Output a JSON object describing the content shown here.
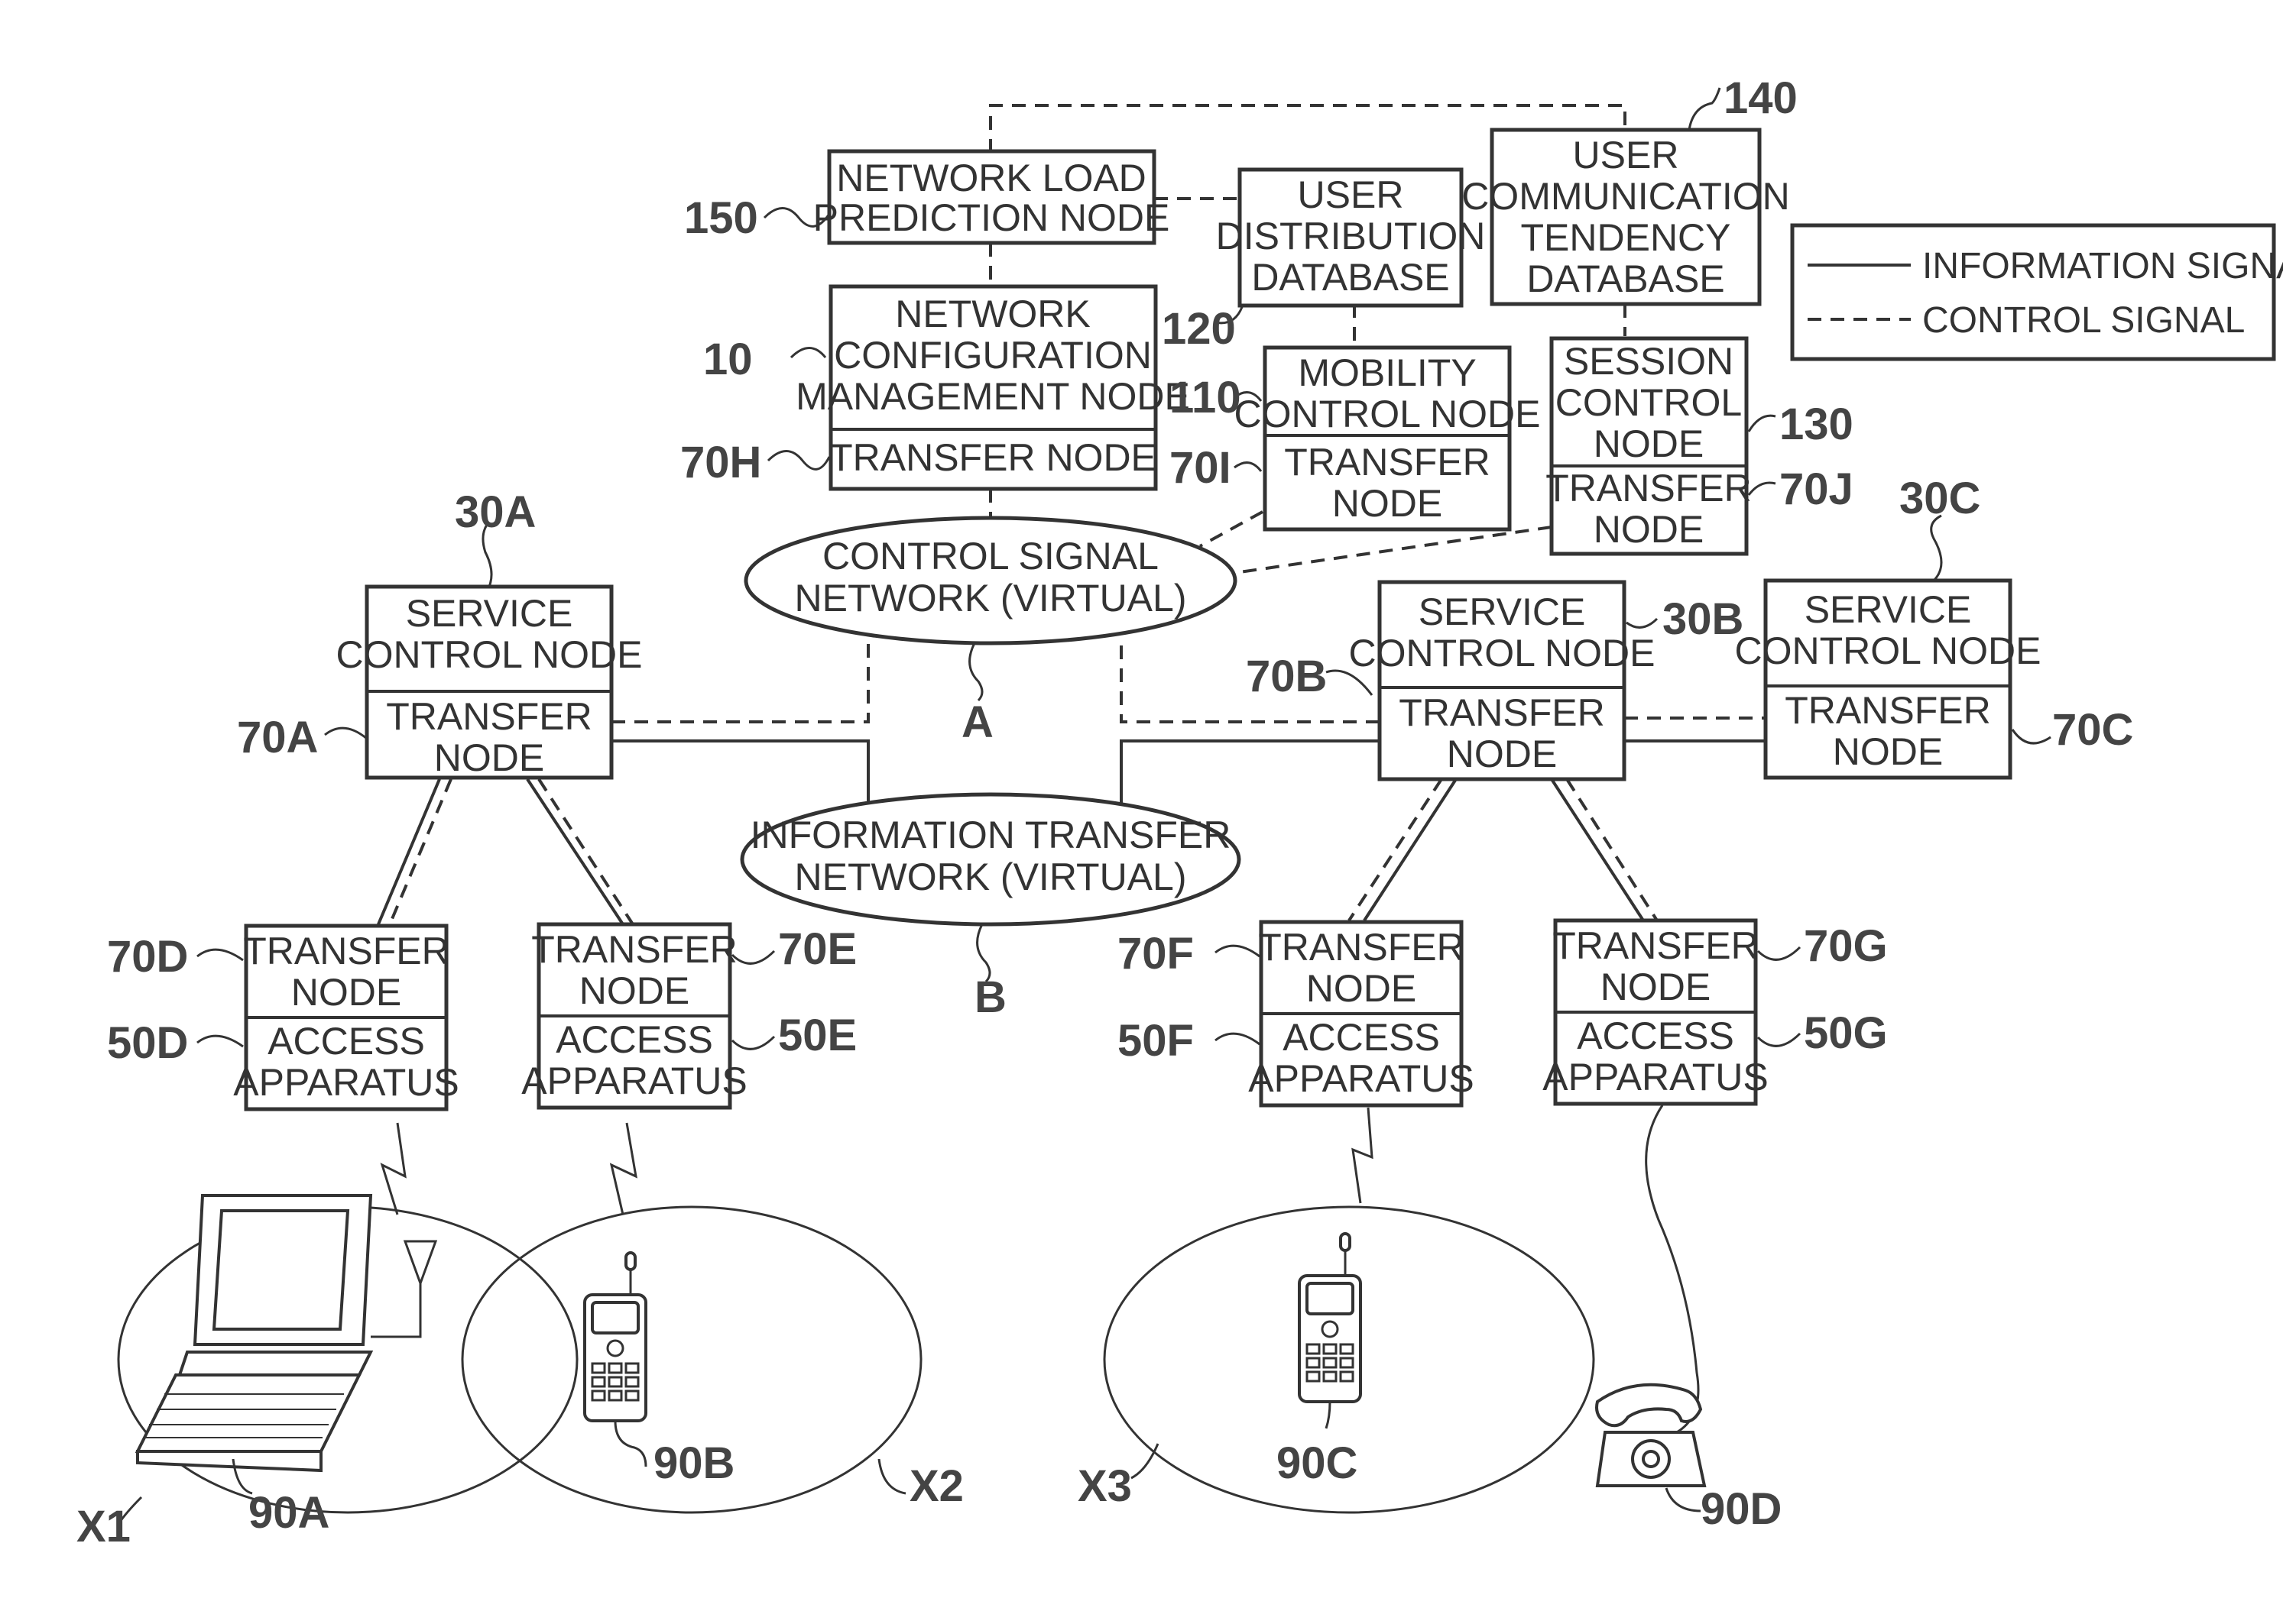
{
  "legend": {
    "information_signal": "INFORMATION SIGNAL",
    "control_signal": "CONTROL SIGNAL"
  },
  "nodes": {
    "n150": {
      "ref": "150",
      "lines": [
        "NETWORK LOAD",
        "PREDICTION NODE"
      ]
    },
    "n120": {
      "ref": "120",
      "lines": [
        "USER",
        "DISTRIBUTION",
        "DATABASE"
      ]
    },
    "n140": {
      "ref": "140",
      "lines": [
        "USER",
        "COMMUNICATION",
        "TENDENCY",
        "DATABASE"
      ]
    },
    "n10": {
      "ref": "10",
      "lines": [
        "NETWORK",
        "CONFIGURATION",
        "MANAGEMENT NODE"
      ]
    },
    "n70H": {
      "ref": "70H",
      "lines": [
        "TRANSFER NODE"
      ]
    },
    "n110": {
      "ref": "110",
      "lines": [
        "MOBILITY",
        "CONTROL NODE"
      ]
    },
    "n70I": {
      "ref": "70I",
      "lines": [
        "TRANSFER",
        "NODE"
      ]
    },
    "n130": {
      "ref": "130",
      "lines": [
        "SESSION",
        "CONTROL",
        "NODE"
      ]
    },
    "n70J": {
      "ref": "70J",
      "lines": [
        "TRANSFER",
        "NODE"
      ]
    },
    "n30A": {
      "ref": "30A",
      "lines": [
        "SERVICE",
        "CONTROL NODE"
      ]
    },
    "n70A": {
      "ref": "70A",
      "lines": [
        "TRANSFER",
        "NODE"
      ]
    },
    "n30B": {
      "ref": "30B",
      "lines": [
        "SERVICE",
        "CONTROL NODE"
      ]
    },
    "n70B": {
      "ref": "70B",
      "lines": [
        "TRANSFER",
        "NODE"
      ]
    },
    "n30C": {
      "ref": "30C",
      "lines": [
        "SERVICE",
        "CONTROL NODE"
      ]
    },
    "n70C": {
      "ref": "70C",
      "lines": [
        "TRANSFER",
        "NODE"
      ]
    },
    "n70D": {
      "ref": "70D",
      "lines": [
        "TRANSFER",
        "NODE"
      ]
    },
    "n50D": {
      "ref": "50D",
      "lines": [
        "ACCESS",
        "APPARATUS"
      ]
    },
    "n70E": {
      "ref": "70E",
      "lines": [
        "TRANSFER",
        "NODE"
      ]
    },
    "n50E": {
      "ref": "50E",
      "lines": [
        "ACCESS",
        "APPARATUS"
      ]
    },
    "n70F": {
      "ref": "70F",
      "lines": [
        "TRANSFER",
        "NODE"
      ]
    },
    "n50F": {
      "ref": "50F",
      "lines": [
        "ACCESS",
        "APPARATUS"
      ]
    },
    "n70G": {
      "ref": "70G",
      "lines": [
        "TRANSFER",
        "NODE"
      ]
    },
    "n50G": {
      "ref": "50G",
      "lines": [
        "ACCESS",
        "APPARATUS"
      ]
    }
  },
  "networks": {
    "control": {
      "ref": "A",
      "lines": [
        "CONTROL SIGNAL",
        "NETWORK (VIRTUAL)"
      ]
    },
    "info": {
      "ref": "B",
      "lines": [
        "INFORMATION TRANSFER",
        "NETWORK (VIRTUAL)"
      ]
    }
  },
  "devices": {
    "d90A": {
      "ref": "90A",
      "type": "laptop-icon"
    },
    "d90B": {
      "ref": "90B",
      "type": "mobile-phone-icon"
    },
    "d90C": {
      "ref": "90C",
      "type": "mobile-phone-icon"
    },
    "d90D": {
      "ref": "90D",
      "type": "telephone-icon"
    }
  },
  "areas": {
    "x1": "X1",
    "x2": "X2",
    "x3": "X3"
  }
}
